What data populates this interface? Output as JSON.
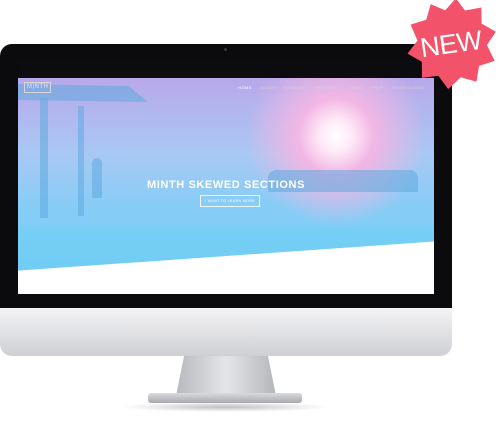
{
  "badge": {
    "label": "NEW",
    "color": "#f2536a"
  },
  "site": {
    "logo": "M|NTH",
    "nav": [
      "HOME",
      "PAGES",
      "FEATURES",
      "PORTFOLIO",
      "BLOG",
      "SHOP",
      "SHORTCODES"
    ],
    "hero_title": "MINTH SKEWED SECTIONS",
    "hero_button": "I WANT TO LEARN MORE"
  }
}
